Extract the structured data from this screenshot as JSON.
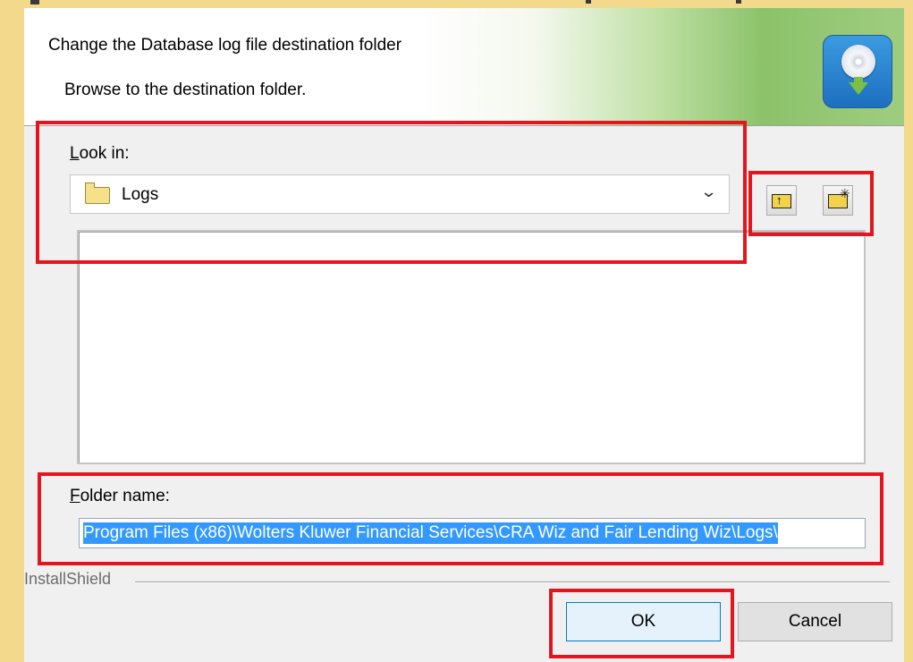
{
  "header": {
    "title": "Change the Database log file destination folder",
    "subtitle": "Browse to the destination folder."
  },
  "lookin": {
    "label_accel": "L",
    "label_rest": "ook in:",
    "selected": "Logs"
  },
  "folder_name": {
    "label_accel": "F",
    "label_rest": "older name:",
    "value": "Program Files (x86)\\Wolters Kluwer Financial Services\\CRA Wiz and Fair Lending Wiz\\Logs\\"
  },
  "branding": "InstallShield",
  "buttons": {
    "ok": "OK",
    "cancel": "Cancel"
  },
  "icons": [
    "app-disc-icon",
    "folder-icon",
    "up-one-level-icon",
    "new-folder-icon",
    "chevron-down-icon"
  ],
  "colors": {
    "highlight": "#e3161f",
    "selection": "#3399ff",
    "frame": "#f3d98c"
  }
}
